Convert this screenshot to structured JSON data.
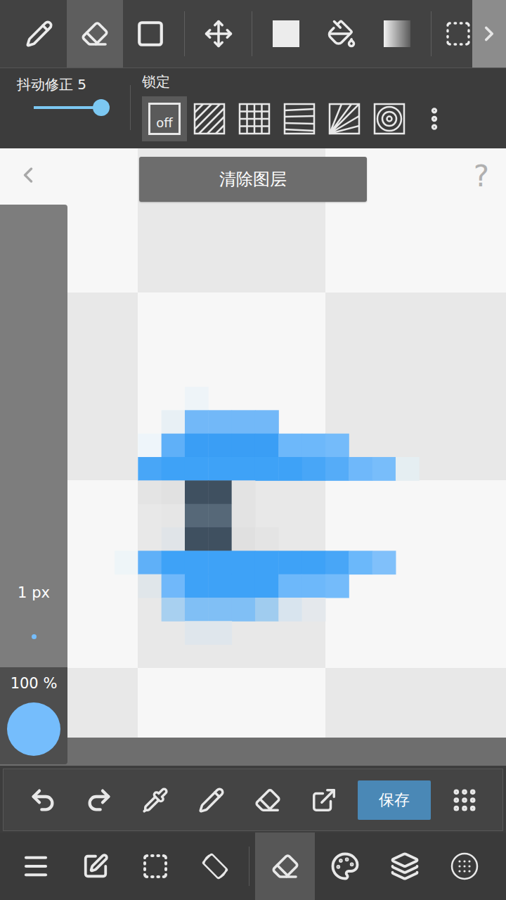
{
  "toolbar": {
    "tools": [
      {
        "kind": "pen",
        "selected": false
      },
      {
        "kind": "eraser",
        "selected": true
      },
      {
        "kind": "shape",
        "selected": false
      },
      {
        "kind": "move",
        "selected": false
      },
      {
        "kind": "fill",
        "selected": false
      },
      {
        "kind": "bucket",
        "selected": false
      },
      {
        "kind": "gradient",
        "selected": false
      },
      {
        "kind": "select",
        "selected": false
      }
    ]
  },
  "options": {
    "stabilizer": {
      "label": "抖动修正 5",
      "level": 1
    },
    "lock": {
      "label": "锁定",
      "modes": [
        {
          "kind": "off",
          "label": "off",
          "selected": true
        },
        {
          "kind": "parallel",
          "selected": false
        },
        {
          "kind": "grid",
          "selected": false
        },
        {
          "kind": "perspective",
          "selected": false
        },
        {
          "kind": "radial",
          "selected": false
        },
        {
          "kind": "concentric",
          "selected": false
        }
      ]
    }
  },
  "canvas": {
    "clear_button": "清除图层",
    "help": "?"
  },
  "brush": {
    "size": "1 px",
    "opacity": "100 %",
    "color": "#75bdfc"
  },
  "actions": [
    {
      "kind": "undo"
    },
    {
      "kind": "redo"
    },
    {
      "kind": "eyedropper"
    },
    {
      "kind": "pen"
    },
    {
      "kind": "eraser"
    },
    {
      "kind": "export"
    },
    {
      "kind": "save",
      "label": "保存"
    },
    {
      "kind": "grid"
    }
  ],
  "nav": [
    {
      "kind": "menu",
      "selected": false
    },
    {
      "kind": "edit",
      "selected": false
    },
    {
      "kind": "select",
      "selected": false
    },
    {
      "kind": "rotate",
      "selected": false
    },
    {
      "kind": "eraser",
      "selected": true
    },
    {
      "kind": "palette",
      "selected": false
    },
    {
      "kind": "layers",
      "selected": false
    },
    {
      "kind": "settings",
      "selected": false
    }
  ]
}
